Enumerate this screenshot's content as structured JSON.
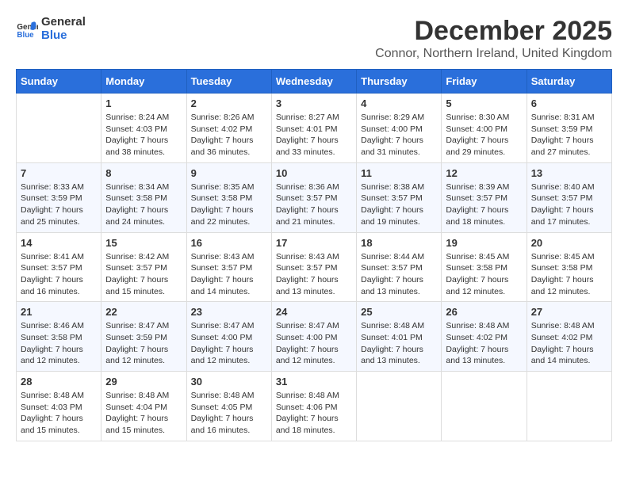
{
  "logo": {
    "general": "General",
    "blue": "Blue"
  },
  "title": "December 2025",
  "location": "Connor, Northern Ireland, United Kingdom",
  "weekdays": [
    "Sunday",
    "Monday",
    "Tuesday",
    "Wednesday",
    "Thursday",
    "Friday",
    "Saturday"
  ],
  "weeks": [
    [
      {
        "day": "",
        "content": ""
      },
      {
        "day": "1",
        "content": "Sunrise: 8:24 AM\nSunset: 4:03 PM\nDaylight: 7 hours\nand 38 minutes."
      },
      {
        "day": "2",
        "content": "Sunrise: 8:26 AM\nSunset: 4:02 PM\nDaylight: 7 hours\nand 36 minutes."
      },
      {
        "day": "3",
        "content": "Sunrise: 8:27 AM\nSunset: 4:01 PM\nDaylight: 7 hours\nand 33 minutes."
      },
      {
        "day": "4",
        "content": "Sunrise: 8:29 AM\nSunset: 4:00 PM\nDaylight: 7 hours\nand 31 minutes."
      },
      {
        "day": "5",
        "content": "Sunrise: 8:30 AM\nSunset: 4:00 PM\nDaylight: 7 hours\nand 29 minutes."
      },
      {
        "day": "6",
        "content": "Sunrise: 8:31 AM\nSunset: 3:59 PM\nDaylight: 7 hours\nand 27 minutes."
      }
    ],
    [
      {
        "day": "7",
        "content": "Sunrise: 8:33 AM\nSunset: 3:59 PM\nDaylight: 7 hours\nand 25 minutes."
      },
      {
        "day": "8",
        "content": "Sunrise: 8:34 AM\nSunset: 3:58 PM\nDaylight: 7 hours\nand 24 minutes."
      },
      {
        "day": "9",
        "content": "Sunrise: 8:35 AM\nSunset: 3:58 PM\nDaylight: 7 hours\nand 22 minutes."
      },
      {
        "day": "10",
        "content": "Sunrise: 8:36 AM\nSunset: 3:57 PM\nDaylight: 7 hours\nand 21 minutes."
      },
      {
        "day": "11",
        "content": "Sunrise: 8:38 AM\nSunset: 3:57 PM\nDaylight: 7 hours\nand 19 minutes."
      },
      {
        "day": "12",
        "content": "Sunrise: 8:39 AM\nSunset: 3:57 PM\nDaylight: 7 hours\nand 18 minutes."
      },
      {
        "day": "13",
        "content": "Sunrise: 8:40 AM\nSunset: 3:57 PM\nDaylight: 7 hours\nand 17 minutes."
      }
    ],
    [
      {
        "day": "14",
        "content": "Sunrise: 8:41 AM\nSunset: 3:57 PM\nDaylight: 7 hours\nand 16 minutes."
      },
      {
        "day": "15",
        "content": "Sunrise: 8:42 AM\nSunset: 3:57 PM\nDaylight: 7 hours\nand 15 minutes."
      },
      {
        "day": "16",
        "content": "Sunrise: 8:43 AM\nSunset: 3:57 PM\nDaylight: 7 hours\nand 14 minutes."
      },
      {
        "day": "17",
        "content": "Sunrise: 8:43 AM\nSunset: 3:57 PM\nDaylight: 7 hours\nand 13 minutes."
      },
      {
        "day": "18",
        "content": "Sunrise: 8:44 AM\nSunset: 3:57 PM\nDaylight: 7 hours\nand 13 minutes."
      },
      {
        "day": "19",
        "content": "Sunrise: 8:45 AM\nSunset: 3:58 PM\nDaylight: 7 hours\nand 12 minutes."
      },
      {
        "day": "20",
        "content": "Sunrise: 8:45 AM\nSunset: 3:58 PM\nDaylight: 7 hours\nand 12 minutes."
      }
    ],
    [
      {
        "day": "21",
        "content": "Sunrise: 8:46 AM\nSunset: 3:58 PM\nDaylight: 7 hours\nand 12 minutes."
      },
      {
        "day": "22",
        "content": "Sunrise: 8:47 AM\nSunset: 3:59 PM\nDaylight: 7 hours\nand 12 minutes."
      },
      {
        "day": "23",
        "content": "Sunrise: 8:47 AM\nSunset: 4:00 PM\nDaylight: 7 hours\nand 12 minutes."
      },
      {
        "day": "24",
        "content": "Sunrise: 8:47 AM\nSunset: 4:00 PM\nDaylight: 7 hours\nand 12 minutes."
      },
      {
        "day": "25",
        "content": "Sunrise: 8:48 AM\nSunset: 4:01 PM\nDaylight: 7 hours\nand 13 minutes."
      },
      {
        "day": "26",
        "content": "Sunrise: 8:48 AM\nSunset: 4:02 PM\nDaylight: 7 hours\nand 13 minutes."
      },
      {
        "day": "27",
        "content": "Sunrise: 8:48 AM\nSunset: 4:02 PM\nDaylight: 7 hours\nand 14 minutes."
      }
    ],
    [
      {
        "day": "28",
        "content": "Sunrise: 8:48 AM\nSunset: 4:03 PM\nDaylight: 7 hours\nand 15 minutes."
      },
      {
        "day": "29",
        "content": "Sunrise: 8:48 AM\nSunset: 4:04 PM\nDaylight: 7 hours\nand 15 minutes."
      },
      {
        "day": "30",
        "content": "Sunrise: 8:48 AM\nSunset: 4:05 PM\nDaylight: 7 hours\nand 16 minutes."
      },
      {
        "day": "31",
        "content": "Sunrise: 8:48 AM\nSunset: 4:06 PM\nDaylight: 7 hours\nand 18 minutes."
      },
      {
        "day": "",
        "content": ""
      },
      {
        "day": "",
        "content": ""
      },
      {
        "day": "",
        "content": ""
      }
    ]
  ]
}
